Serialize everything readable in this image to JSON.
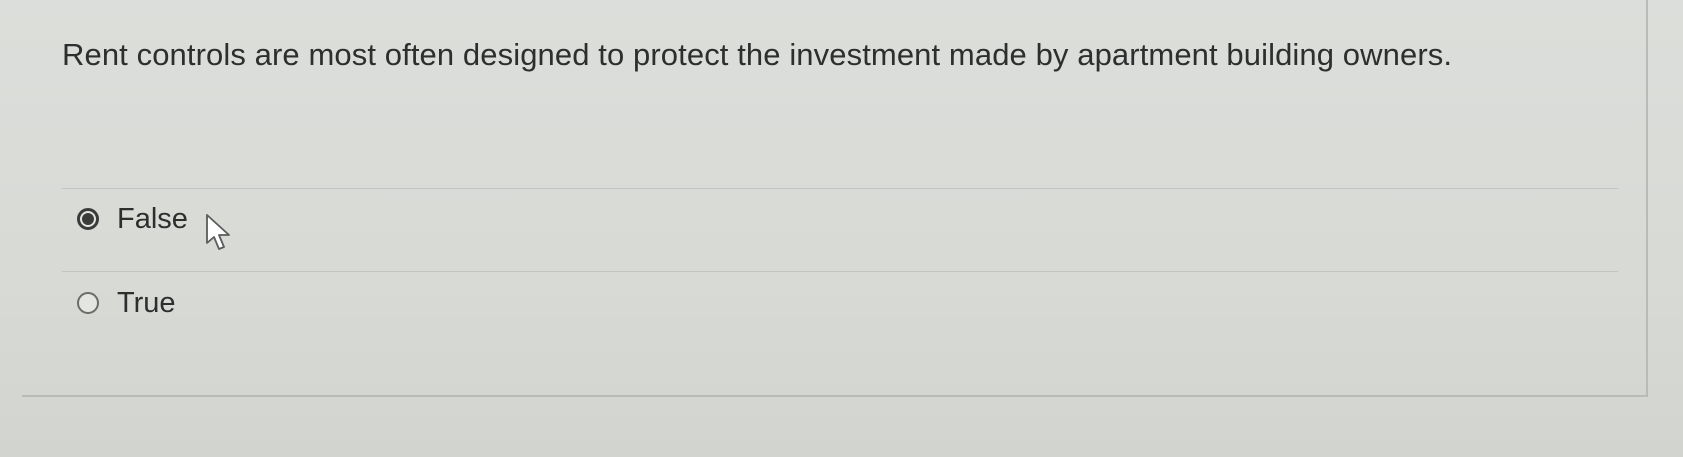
{
  "question": {
    "text": "Rent controls are most often designed to protect the investment made by apartment building owners."
  },
  "options": [
    {
      "label": "False",
      "selected": true
    },
    {
      "label": "True",
      "selected": false
    }
  ],
  "colors": {
    "background": "#d9dbd8",
    "text": "#2d2e2e",
    "radio_border": "#6b6d6b",
    "radio_fill": "#3a3b3b"
  }
}
